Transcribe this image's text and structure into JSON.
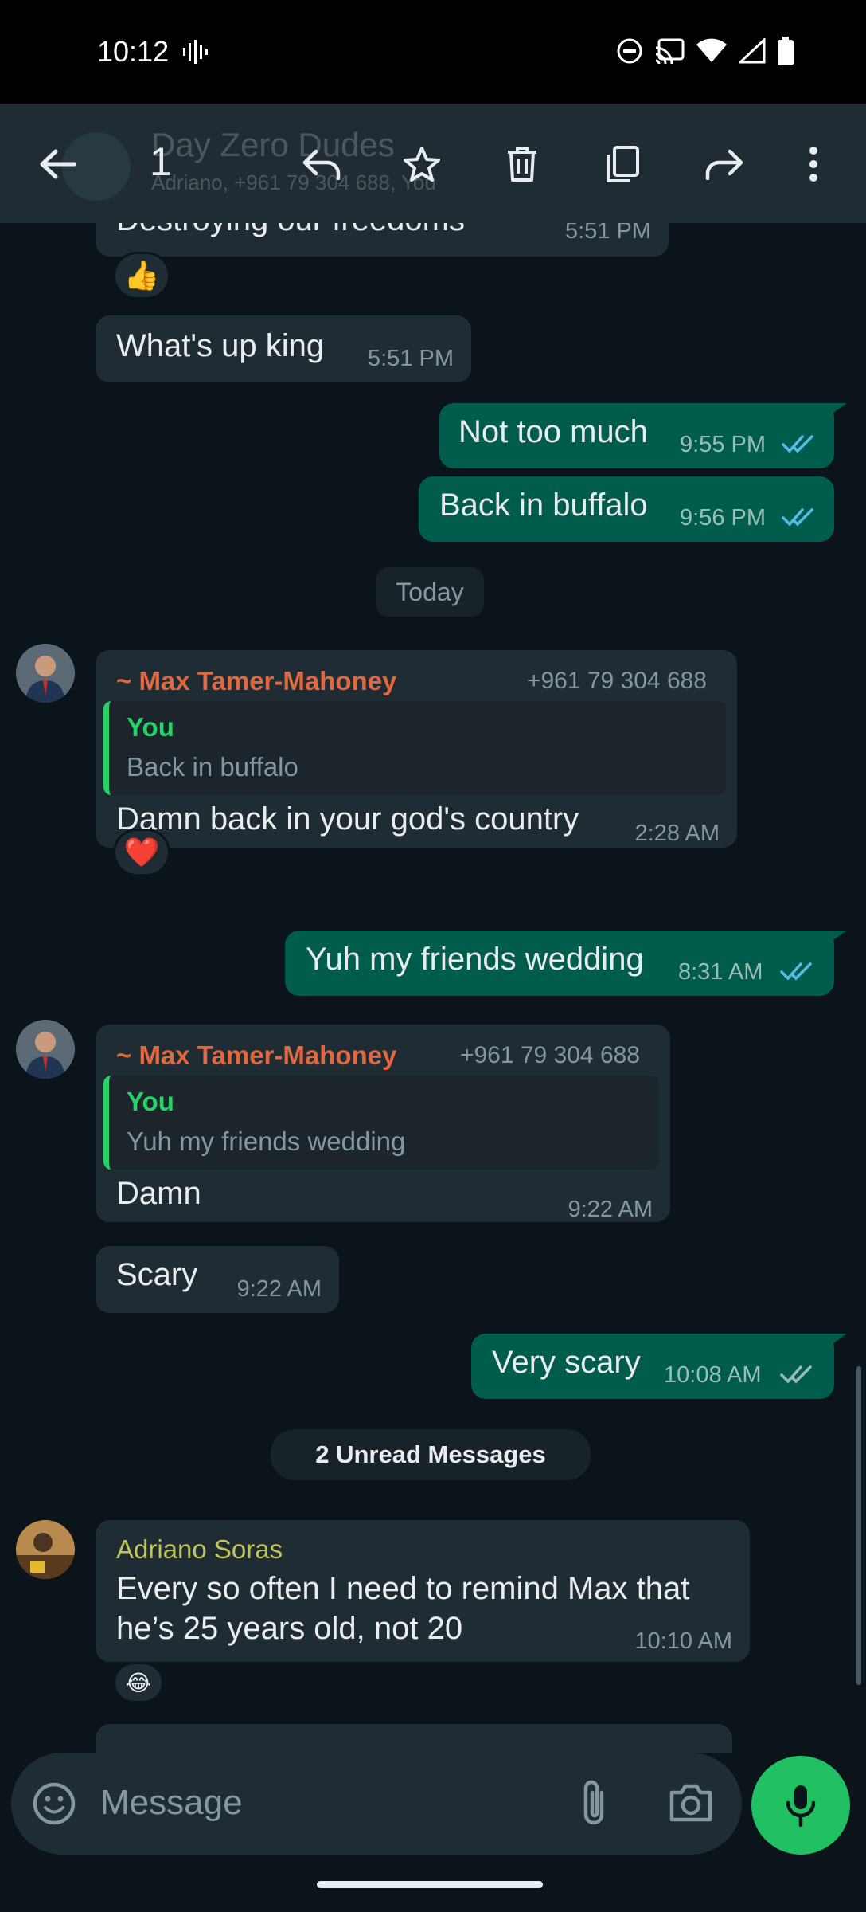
{
  "status_bar": {
    "time": "10:12"
  },
  "app_bar": {
    "selected_count": "1",
    "group_name": "Day Zero Dudes",
    "group_members": "Adriano, +961 79 304 688, You"
  },
  "messages": {
    "m0": {
      "text": "Destroying our freedoms",
      "time": "5:51 PM",
      "reaction": "👍"
    },
    "m1": {
      "text": "What's up king",
      "time": "5:51 PM"
    },
    "m2": {
      "text": "Not too much",
      "time": "9:55 PM"
    },
    "m3": {
      "text": "Back in buffalo",
      "time": "9:56 PM"
    },
    "date_divider": "Today",
    "m4": {
      "sender": "~ Max Tamer-Mahoney",
      "phone": "+961 79 304 688",
      "quote_sender": "You",
      "quote_text": "Back in buffalo",
      "text": "Damn back in your god's country",
      "time": "2:28 AM",
      "reaction": "❤️"
    },
    "m5": {
      "text": "Yuh my friends wedding",
      "time": "8:31 AM"
    },
    "m6": {
      "sender": "~ Max Tamer-Mahoney",
      "phone": "+961 79 304 688",
      "quote_sender": "You",
      "quote_text": "Yuh my friends wedding",
      "text": "Damn",
      "time": "9:22 AM"
    },
    "m7": {
      "text": "Scary",
      "time": "9:22 AM"
    },
    "m8": {
      "text": "Very scary",
      "time": "10:08 AM"
    },
    "unread_divider": "2 Unread Messages",
    "m9": {
      "sender": "Adriano Soras",
      "line1": "Every so often I need to remind Max that",
      "line2": "he’s 25 years old, not 20",
      "time": "10:10 AM",
      "reaction": "😂"
    }
  },
  "composer": {
    "placeholder": "Message"
  },
  "colors": {
    "background": "#0b141a",
    "incoming": "#202c33",
    "outgoing": "#005c4b",
    "read_ticks": "#53bdeb",
    "accent_green": "#21c063",
    "sender_orange": "#e06840",
    "sender_olive": "#c2c45a"
  }
}
